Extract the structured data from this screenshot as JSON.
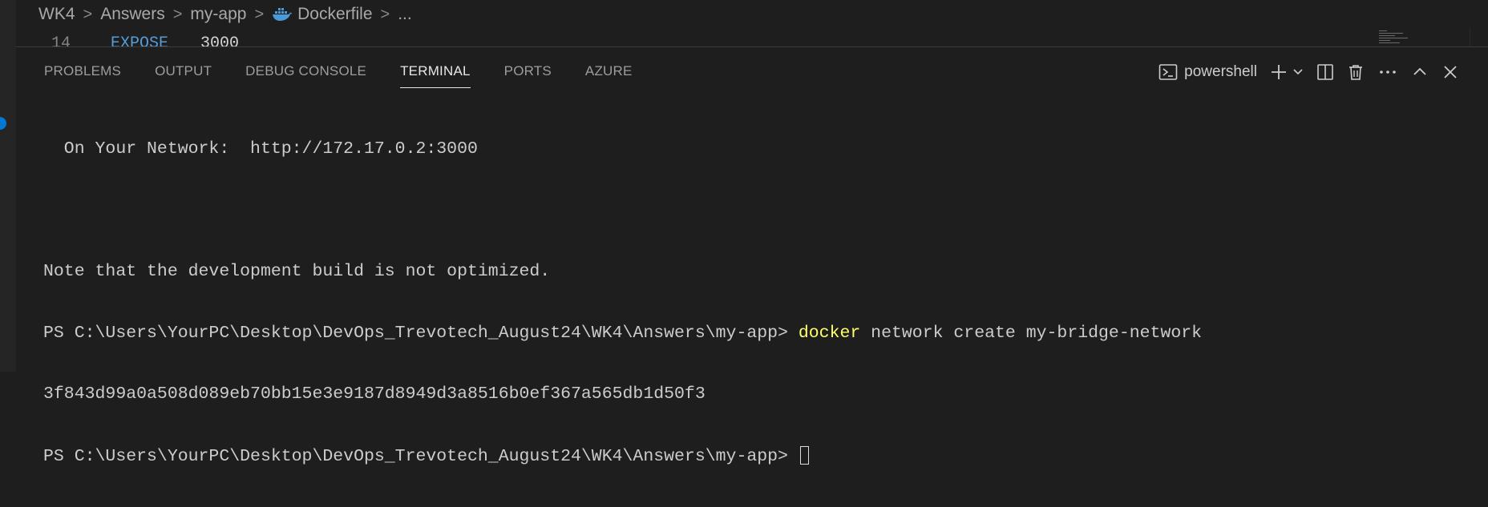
{
  "breadcrumb": {
    "items": [
      "WK4",
      "Answers",
      "my-app",
      "Dockerfile",
      "..."
    ],
    "separator": ">"
  },
  "editor": {
    "line_number": "14",
    "keyword": "EXPOSE",
    "value": "3000"
  },
  "panel": {
    "tabs": [
      "PROBLEMS",
      "OUTPUT",
      "DEBUG CONSOLE",
      "TERMINAL",
      "PORTS",
      "AZURE"
    ],
    "active_tab": "TERMINAL",
    "shell_label": "powershell",
    "icons": [
      "terminal-icon",
      "plus-icon",
      "chevron-down-icon",
      "split-icon",
      "trash-icon",
      "ellipsis-icon",
      "chevron-up-icon",
      "close-icon"
    ]
  },
  "terminal": {
    "network_line": "  On Your Network:  http://172.17.0.2:3000",
    "note_line": "Note that the development build is not optimized.",
    "prompt": "PS C:\\Users\\YourPC\\Desktop\\DevOps_Trevotech_August24\\WK4\\Answers\\my-app> ",
    "cmd_name": "docker",
    "cmd_args": " network create my-bridge-network",
    "hash_line": "3f843d99a0a508d089eb70bb15e3e9187d8949d3a8516b0ef367a565db1d50f3"
  },
  "colors": {
    "background": "#1e1e1e",
    "command": "#ffff66",
    "keyword": "#569cd6",
    "accent": "#0078d4"
  }
}
